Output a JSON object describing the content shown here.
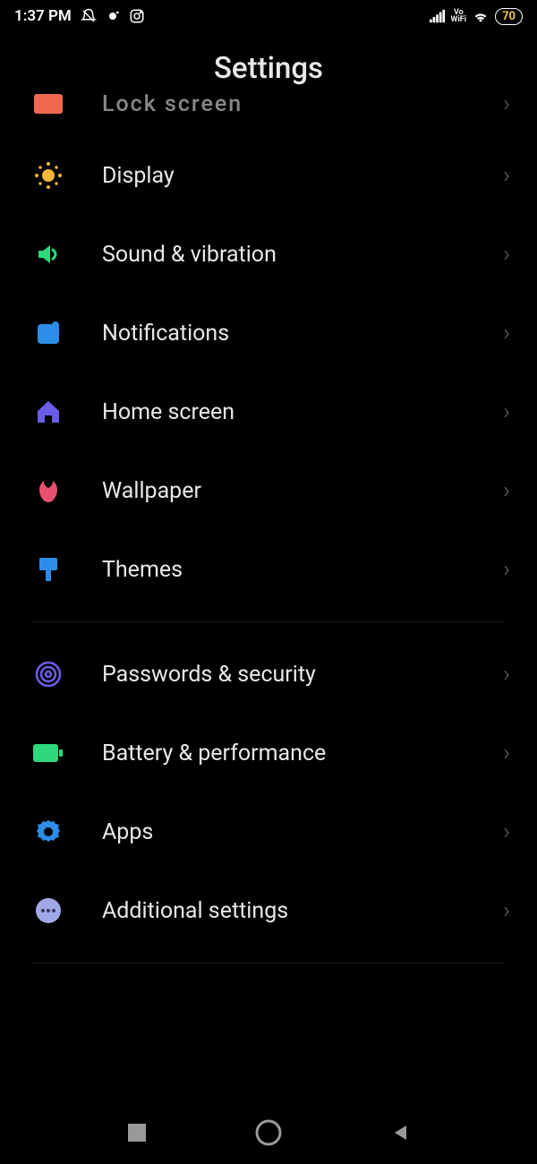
{
  "statusBar": {
    "time": "1:37 PM",
    "battery": "70"
  },
  "pageTitle": "Settings",
  "items": [
    {
      "id": "lock-screen",
      "label": "Lock screen",
      "partial": true
    },
    {
      "id": "display",
      "label": "Display"
    },
    {
      "id": "sound",
      "label": "Sound & vibration"
    },
    {
      "id": "notifications",
      "label": "Notifications"
    },
    {
      "id": "home-screen",
      "label": "Home screen"
    },
    {
      "id": "wallpaper",
      "label": "Wallpaper"
    },
    {
      "id": "themes",
      "label": "Themes"
    }
  ],
  "items2": [
    {
      "id": "passwords",
      "label": "Passwords & security"
    },
    {
      "id": "battery",
      "label": "Battery & performance"
    },
    {
      "id": "apps",
      "label": "Apps"
    },
    {
      "id": "additional",
      "label": "Additional settings"
    }
  ]
}
